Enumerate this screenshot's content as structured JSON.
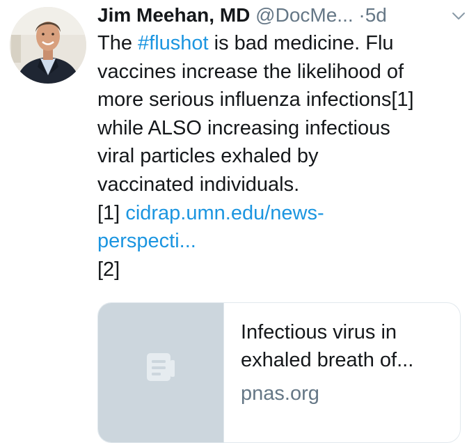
{
  "tweet": {
    "author_name": "Jim Meehan, MD",
    "author_handle": "@DocMe...",
    "separator": "·",
    "time": "5d",
    "menu_icon": "chevron-down-icon",
    "avatar_icon": "profile-photo",
    "text": {
      "line1_before": "The ",
      "hashtag": "#flushot",
      "line1_after": " is bad medicine. Flu",
      "line2": "vaccines increase the likelihood of",
      "line3": "more serious influenza infections[1]",
      "line4": "while ALSO increasing infectious",
      "line5": "viral particles exhaled by",
      "line6": "vaccinated individuals.",
      "ref1_label": "[1] ",
      "ref1_link_line1": "cidrap.umn.edu/news-",
      "ref1_link_line2": "perspecti...",
      "ref2_label": "[2]"
    }
  },
  "card": {
    "thumbnail_icon": "document-icon",
    "title_line1": "Infectious virus in",
    "title_line2": "exhaled breath of...",
    "domain": "pnas.org"
  },
  "colors": {
    "link": "#1b95e0",
    "text": "#14171a",
    "muted": "#657786",
    "card_border": "#e1e8ed",
    "thumb_bg": "#ccd6dd"
  }
}
